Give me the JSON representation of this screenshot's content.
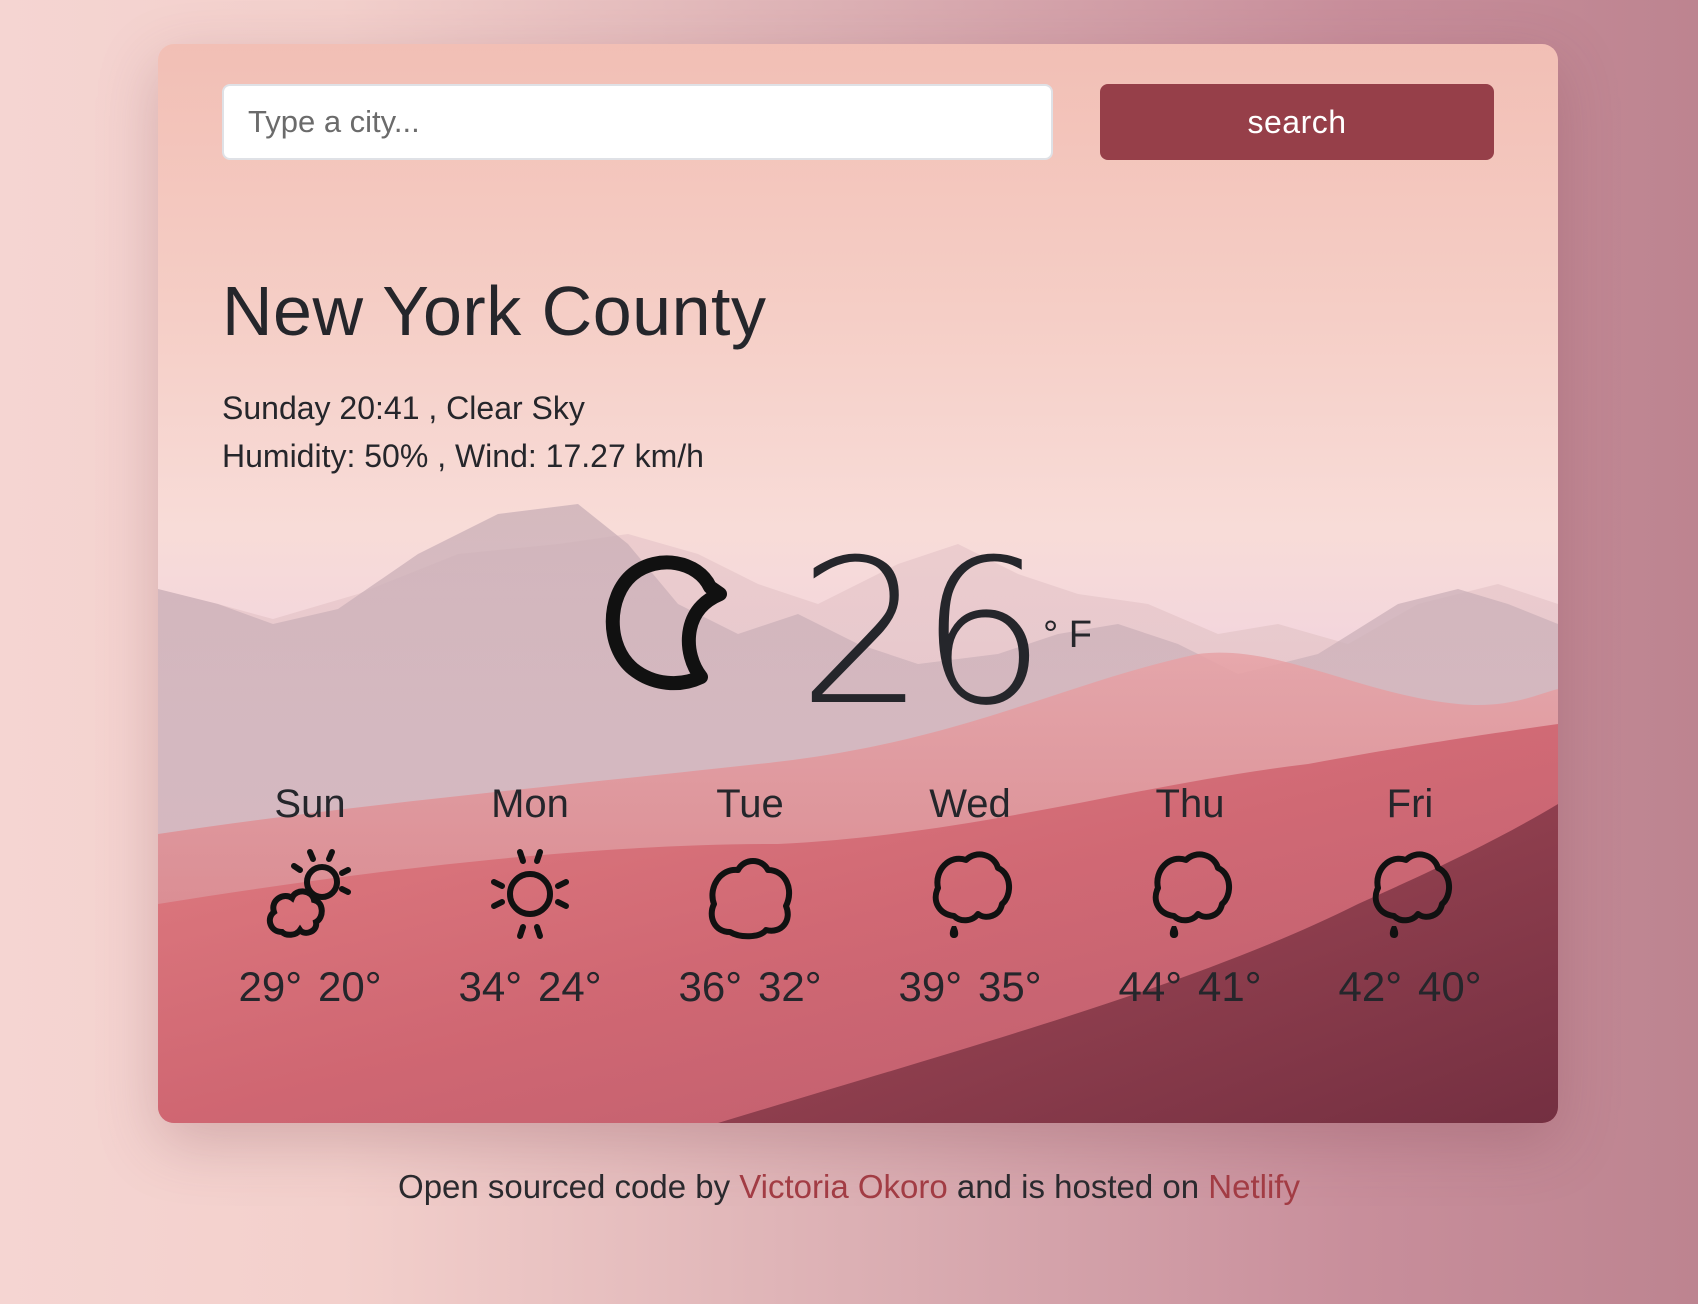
{
  "search": {
    "placeholder": "Type a city...",
    "value": "",
    "button_label": "search"
  },
  "current": {
    "city": "New York County",
    "datetime_condition": "Sunday 20:41 , Clear Sky",
    "humidity_wind": "Humidity: 50% , Wind: 17.27 km/h",
    "temperature": "26",
    "unit": "° F",
    "icon": "clear-night-moon-icon"
  },
  "forecast": [
    {
      "day": "Sun",
      "high": "29°",
      "low": "20°",
      "icon": "partly-cloudy-icon"
    },
    {
      "day": "Mon",
      "high": "34°",
      "low": "24°",
      "icon": "sun-icon"
    },
    {
      "day": "Tue",
      "high": "36°",
      "low": "32°",
      "icon": "cloud-icon"
    },
    {
      "day": "Wed",
      "high": "39°",
      "low": "35°",
      "icon": "rain-cloud-icon"
    },
    {
      "day": "Thu",
      "high": "44°",
      "low": "41°",
      "icon": "rain-cloud-icon"
    },
    {
      "day": "Fri",
      "high": "42°",
      "low": "40°",
      "icon": "rain-cloud-icon"
    }
  ],
  "footer": {
    "prefix": "Open sourced code by ",
    "author": "Victoria Okoro",
    "middle": " and is hosted on ",
    "host": "Netlify"
  },
  "colors": {
    "accent": "#963f49",
    "link": "#a23c44",
    "text": "#25262b"
  }
}
